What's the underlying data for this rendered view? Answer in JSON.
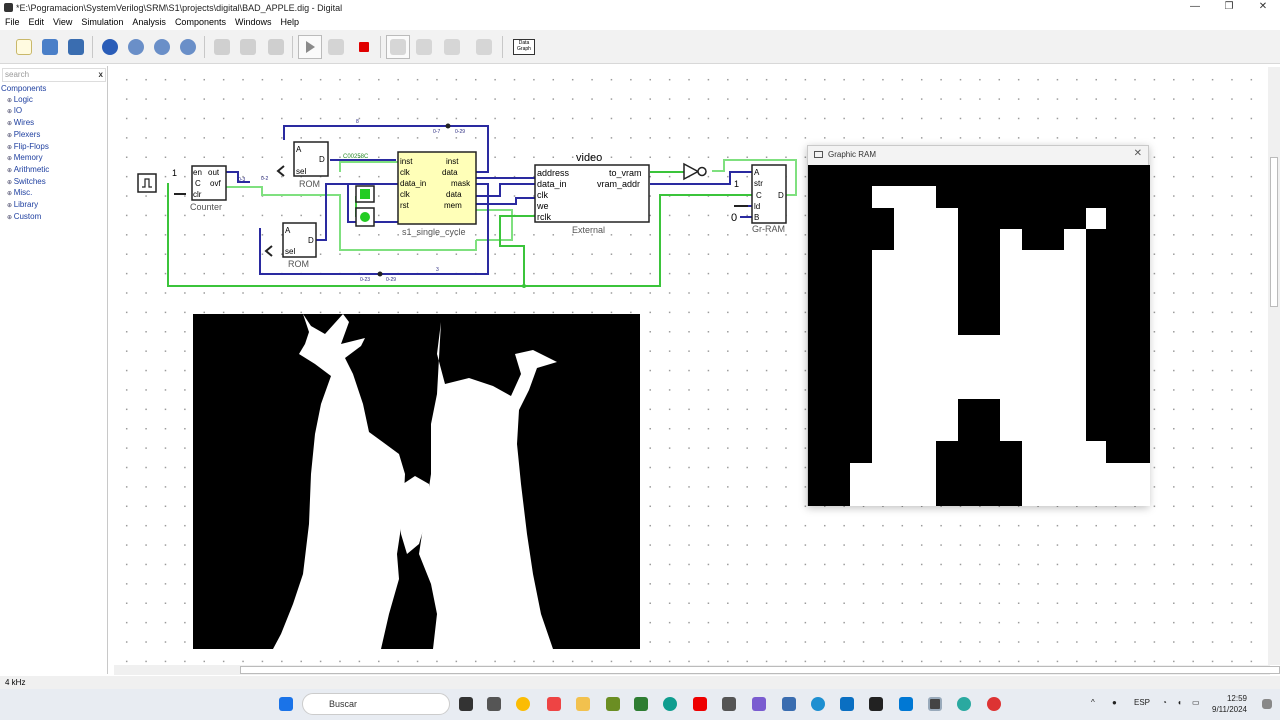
{
  "window": {
    "title": "*E:\\Pogramacion\\SystemVerilog\\SRM\\S1\\projects\\digital\\BAD_APPLE.dig - Digital",
    "controls": [
      "—",
      "❐",
      "✕"
    ]
  },
  "menu": [
    "File",
    "Edit",
    "View",
    "Simulation",
    "Analysis",
    "Components",
    "Windows",
    "Help"
  ],
  "toolbar": {
    "data_graph_label": "Data\nGraph"
  },
  "sidebar": {
    "search_placeholder": "search",
    "clear": "x",
    "root": "Components",
    "items": [
      "Logic",
      "IO",
      "Wires",
      "Plexers",
      "Flip-Flops",
      "Memory",
      "Arithmetic",
      "Switches",
      "Misc.",
      "Library",
      "Custom"
    ]
  },
  "circuit": {
    "counter_label": "Counter",
    "counter_pins": [
      "en",
      "out",
      "C",
      "ovf",
      "clr"
    ],
    "const_one": "1",
    "rom1_label": "ROM",
    "rom2_label": "ROM",
    "rom_pins": [
      "A",
      "D",
      "sel"
    ],
    "cpu_label": "s1_single_cycle",
    "cpu_in": [
      "inst",
      "clk",
      "data_in",
      "clk",
      "rst"
    ],
    "cpu_out": [
      "inst",
      "data",
      "mask",
      "data",
      "mem"
    ],
    "ext_label": "External",
    "ext_title": "video",
    "ext_in": [
      "address",
      "data_in",
      "clk",
      "we",
      "rclk"
    ],
    "ext_out": [
      "to_vram",
      "vram_addr"
    ],
    "gram_label": "Gr-RAM",
    "gram_pins": [
      "A",
      "str",
      "C",
      "ld",
      "B",
      "D"
    ],
    "gram_const_one": "1",
    "gram_const_zero": "0",
    "hex_value": "C00258C",
    "bus_labels": [
      "8",
      "0-7",
      "0-29",
      "3",
      "0-23",
      "0-29",
      "0-3",
      "0-2"
    ]
  },
  "graphic_ram": {
    "title": "Graphic RAM",
    "close": "✕"
  },
  "status": {
    "frequency": "4 kHz"
  },
  "taskbar": {
    "search": "Buscar",
    "lang": "ESP",
    "time": "12:59",
    "date": "9/11/2024"
  }
}
